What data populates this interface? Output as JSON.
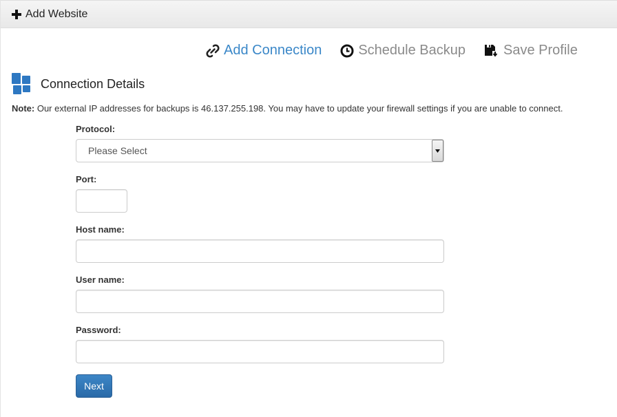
{
  "header": {
    "icon": "plus-icon",
    "title": "Add Website"
  },
  "toolbar": {
    "items": [
      {
        "label": "Add Connection",
        "icon": "link-icon",
        "active": true
      },
      {
        "label": "Schedule Backup",
        "icon": "clock-icon",
        "active": false
      },
      {
        "label": "Save Profile",
        "icon": "save-icon",
        "active": false
      }
    ]
  },
  "section": {
    "icon": "blocks-icon",
    "title": "Connection Details"
  },
  "note": {
    "prefix": "Note:",
    "text": " Our external IP addresses for backups is 46.137.255.198. You may have to update your firewall settings if you are unable to connect."
  },
  "form": {
    "protocol": {
      "label": "Protocol:",
      "value": "Please Select"
    },
    "port": {
      "label": "Port:",
      "value": ""
    },
    "host": {
      "label": "Host name:",
      "value": ""
    },
    "user": {
      "label": "User name:",
      "value": ""
    },
    "password": {
      "label": "Password:",
      "value": ""
    },
    "next_label": "Next"
  },
  "colors": {
    "accent": "#3a87c8",
    "button": "#337ab7",
    "muted": "#8a8a8a"
  }
}
